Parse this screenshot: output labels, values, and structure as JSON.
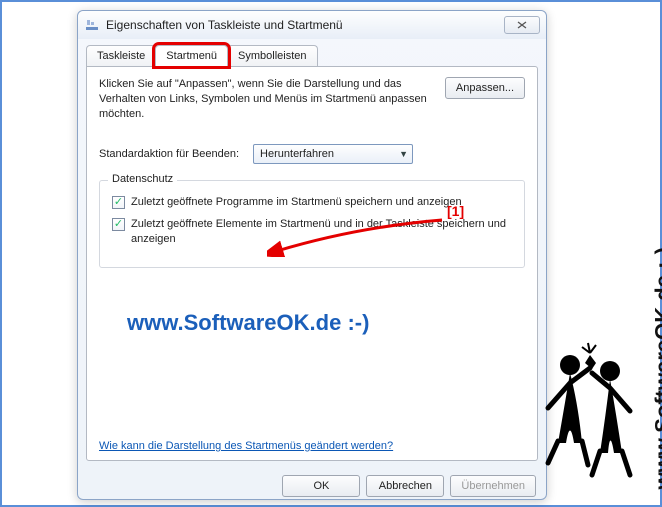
{
  "window": {
    "title": "Eigenschaften von Taskleiste und Startmenü"
  },
  "tabs": {
    "t0": "Taskleiste",
    "t1": "Startmenü",
    "t2": "Symbolleisten"
  },
  "panel": {
    "intro": "Klicken Sie auf \"Anpassen\", wenn Sie die Darstellung und das Verhalten von Links, Symbolen und Menüs im Startmenü anpassen möchten.",
    "customize_btn": "Anpassen...",
    "action_label": "Standardaktion für Beenden:",
    "action_value": "Herunterfahren",
    "group_title": "Datenschutz",
    "chk1": "Zuletzt geöffnete Programme im Startmenü speichern und anzeigen",
    "chk2": "Zuletzt geöffnete Elemente im Startmenü und in der Taskleiste speichern und anzeigen",
    "help_link": "Wie kann die Darstellung des Startmenüs geändert werden?"
  },
  "buttons": {
    "ok": "OK",
    "cancel": "Abbrechen",
    "apply": "Übernehmen"
  },
  "annotation": {
    "num": "[1]"
  },
  "watermark": {
    "horizontal": "www.SoftwareOK.de :-)",
    "vertical": "www.SoftwareOK.de :-)"
  }
}
